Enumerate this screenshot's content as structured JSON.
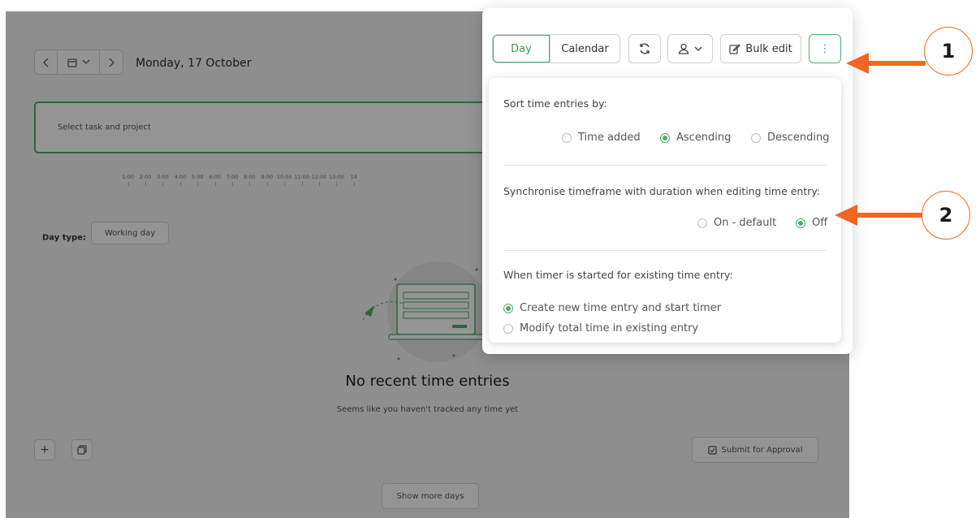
{
  "header": {
    "date": "Monday, 17 October"
  },
  "task_bar": {
    "placeholder": "Select task and project"
  },
  "timeline": {
    "ticks": [
      "1:00",
      "2:00",
      "3:00",
      "4:00",
      "5:00",
      "6:00",
      "7:00",
      "8:00",
      "9:00",
      "10:00",
      "11:00",
      "12:00",
      "13:00",
      "14"
    ]
  },
  "day_type": {
    "label": "Day type:",
    "value": "Working day"
  },
  "empty_state": {
    "title": "No recent time entries",
    "subtitle": "Seems like you haven't tracked any time yet"
  },
  "bottom": {
    "add_symbol": "+",
    "submit_label": "Submit for Approval",
    "show_more_label": "Show more days"
  },
  "toolbar": {
    "day_label": "Day",
    "calendar_label": "Calendar",
    "bulk_edit_label": "Bulk edit",
    "more_symbol": "⋮"
  },
  "menu": {
    "sort": {
      "label": "Sort time entries by:",
      "options": [
        "Time added",
        "Ascending",
        "Descending"
      ],
      "selected": "Ascending"
    },
    "sync": {
      "label": "Synchronise timeframe with duration when editing time entry:",
      "options": [
        "On - default",
        "Off"
      ],
      "selected": "Off"
    },
    "timer": {
      "label": "When timer is started for existing time entry:",
      "options": [
        "Create new time entry and start timer",
        "Modify total time in existing entry"
      ],
      "selected": "Create new time entry and start timer"
    }
  },
  "annotations": {
    "one": "1",
    "two": "2",
    "color": "#f26522"
  },
  "colors": {
    "accent": "#4caf6a"
  }
}
